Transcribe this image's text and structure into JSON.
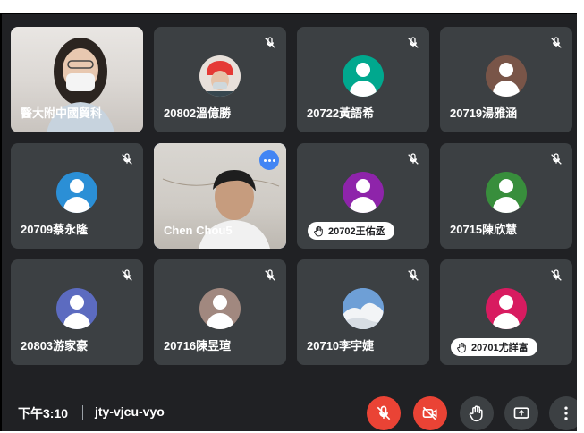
{
  "meeting": {
    "time": "下午3:10",
    "code": "jty-vjcu-vyo"
  },
  "colors": {
    "background": "#202124",
    "tile": "#3c4043",
    "end_red": "#ea4335",
    "speaking_blue": "#8ab4f8"
  },
  "participants": [
    {
      "name": "醫大附中國貿科",
      "video": true,
      "muted": false
    },
    {
      "name": "20802溫億勝",
      "video": false,
      "muted": true,
      "avatar": "photo"
    },
    {
      "name": "20722黃語希",
      "video": false,
      "muted": true,
      "avatar_color": "#00a88e"
    },
    {
      "name": "20719湯雅涵",
      "video": false,
      "muted": true,
      "avatar_color": "#795548"
    },
    {
      "name": "20709蔡永隆",
      "video": false,
      "muted": true,
      "avatar_color": "#2b8fd6"
    },
    {
      "name": "Chen Chou5",
      "video": true,
      "muted": false,
      "speaking": true
    },
    {
      "name": "20702王佑丞",
      "video": false,
      "muted": true,
      "hand_raised": true,
      "avatar_color": "#8e24aa"
    },
    {
      "name": "20715陳欣慧",
      "video": false,
      "muted": true,
      "avatar_color": "#388e3c"
    },
    {
      "name": "20803游家豪",
      "video": false,
      "muted": true,
      "avatar_color": "#5c6bc0"
    },
    {
      "name": "20716陳昱瑄",
      "video": false,
      "muted": true,
      "avatar_color": "#a1887f"
    },
    {
      "name": "20710李宇婕",
      "video": false,
      "muted": true,
      "avatar": "photo"
    },
    {
      "name": "20701尤詳富",
      "video": false,
      "muted": true,
      "hand_raised": true,
      "avatar_color": "#d81b60"
    }
  ],
  "controls": [
    {
      "icon": "mic-off-icon",
      "style": "red"
    },
    {
      "icon": "camera-off-icon",
      "style": "red"
    },
    {
      "icon": "raise-hand-icon",
      "style": "grey"
    },
    {
      "icon": "present-screen-icon",
      "style": "grey"
    },
    {
      "icon": "more-options-icon",
      "style": "grey"
    }
  ]
}
